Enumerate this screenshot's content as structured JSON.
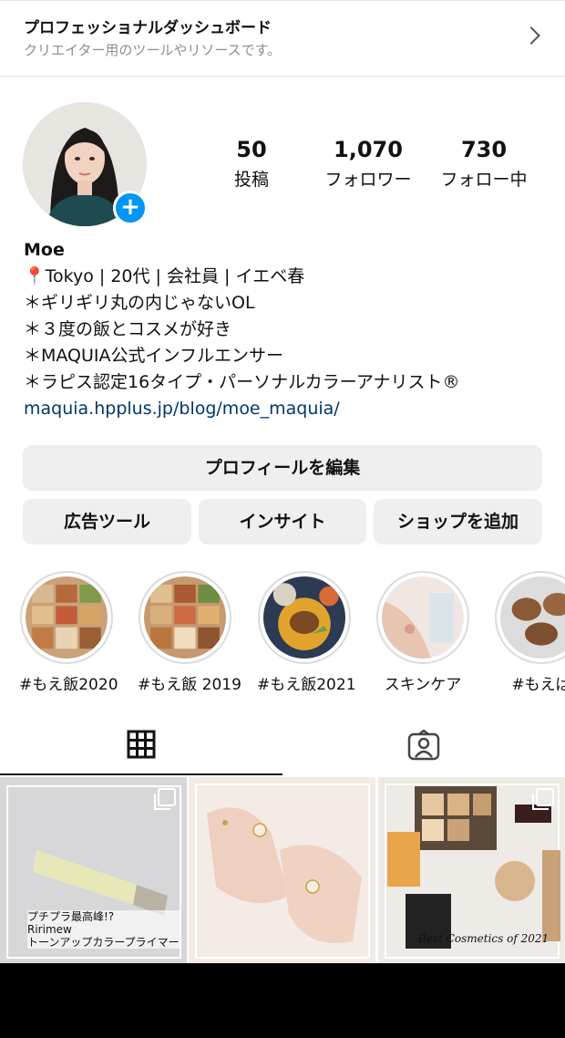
{
  "dashboard": {
    "title": "プロフェッショナルダッシュボード",
    "subtitle": "クリエイター用のツールやリソースです。"
  },
  "stats": [
    {
      "value": "50",
      "label": "投稿"
    },
    {
      "value": "1,070",
      "label": "フォロワー"
    },
    {
      "value": "730",
      "label": "フォロー中"
    }
  ],
  "profile": {
    "name": "Moe",
    "bio": [
      "📍Tokyo | 20代 | 会社員 | イエベ春",
      "＊ギリギリ丸の内じゃないOL",
      "＊３度の飯とコスメが好き",
      "＊MAQUIA公式インフルエンサー",
      "＊ラピス認定16タイプ・パーソナルカラーアナリスト®"
    ],
    "link": "maquia.hpplus.jp/blog/moe_maquia/"
  },
  "buttons": {
    "edit_profile": "プロフィールを編集",
    "ad_tools": "広告ツール",
    "insights": "インサイト",
    "add_shop": "ショップを追加"
  },
  "highlights": [
    {
      "label": "#もえ飯2020"
    },
    {
      "label": "#もえ飯 2019"
    },
    {
      "label": "#もえ飯2021"
    },
    {
      "label": "スキンケア"
    },
    {
      "label": "#もえぱ"
    }
  ],
  "tabs": {
    "grid_icon": "grid-icon",
    "tagged_icon": "tagged-person-icon"
  },
  "posts": [
    {
      "caption_lines": [
        "プチプラ最高峰!?",
        "Ririmew",
        "トーンアップカラープライマー"
      ],
      "product_text": "Ririmew"
    },
    {
      "caption_lines": []
    },
    {
      "caption_lines": [
        "Best Cosmetics of 2021"
      ]
    }
  ],
  "colors": {
    "accent_blue": "#0095f6",
    "link_blue": "#00376b",
    "button_gray": "#efefef"
  }
}
